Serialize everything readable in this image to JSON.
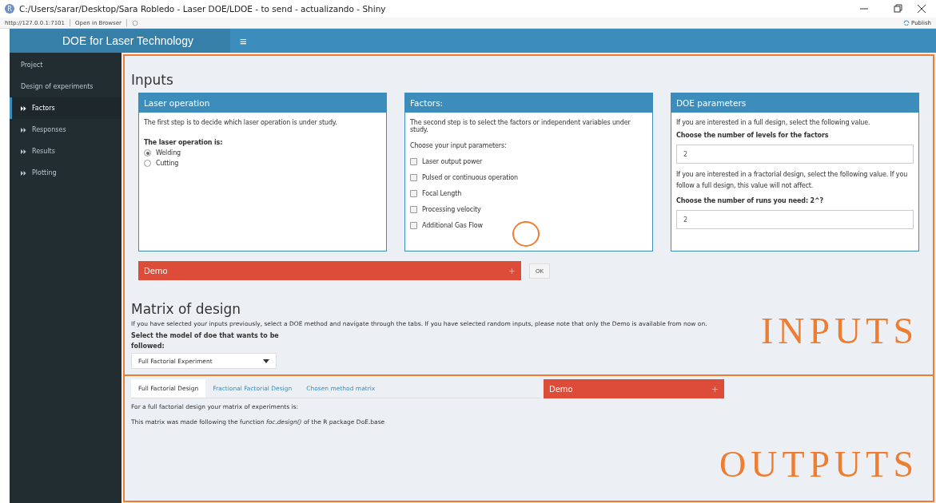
{
  "window": {
    "title": "C:/Users/sarar/Desktop/Sara Robledo - Laser DOE/LDOE - to send - actualizando - Shiny",
    "app_icon": "R"
  },
  "toolbar": {
    "url": "http://127.0.0.1:7101",
    "open_in_browser": "Open in Browser",
    "publish": "Publish"
  },
  "header": {
    "title": "DOE for Laser Technology",
    "menu": "≡"
  },
  "sidebar": {
    "items": [
      {
        "label": "Project",
        "kind": "plain",
        "selected": false
      },
      {
        "label": "Design of experiments",
        "kind": "plain",
        "selected": false
      },
      {
        "label": "Factors",
        "kind": "sub",
        "selected": true
      },
      {
        "label": "Responses",
        "kind": "sub",
        "selected": false
      },
      {
        "label": "Results",
        "kind": "sub",
        "selected": false
      },
      {
        "label": "Plotting",
        "kind": "sub",
        "selected": false
      }
    ]
  },
  "inputs": {
    "heading": "Inputs",
    "laser_operation": {
      "title": "Laser operation",
      "text": "The first step is to decide which laser operation is under study.",
      "label": "The laser operation is:",
      "options": [
        {
          "label": "Welding",
          "selected": true
        },
        {
          "label": "Cutting",
          "selected": false
        }
      ]
    },
    "factors": {
      "title": "Factors:",
      "text": "The second step is to select the factors or independent variables under study.",
      "label": "Choose your input parameters:",
      "options": [
        {
          "label": "Laser output power",
          "checked": false
        },
        {
          "label": "Pulsed or continuous operation",
          "checked": false
        },
        {
          "label": "Focal Length",
          "checked": false
        },
        {
          "label": "Processing velocity",
          "checked": false
        },
        {
          "label": "Additional Gas Flow",
          "checked": false
        }
      ]
    },
    "doe_parameters": {
      "title": "DOE parameters",
      "text_1": "If you are interested in a full design, select the following value.",
      "levels_label": "Choose the number of levels for the factors",
      "levels_value": "2",
      "text_2": "If you are interested in a fractorial design, select the following value. If you follow a full design, this value will not affect.",
      "runs_label": "Choose the number of runs you need: 2^?",
      "runs_value": "2"
    },
    "demo": {
      "title": "Demo",
      "toggle": "+"
    },
    "ok_button": "OK"
  },
  "matrix": {
    "heading": "Matrix of design",
    "text": "If you have selected your inputs previously, select a DOE method and navigate through the tabs. If you have selected random inputs, please note that only the Demo is available from now on.",
    "select_label": "Select the model of doe that wants to be followed:",
    "select_value": "Full Factorial Experiment"
  },
  "outputs": {
    "tabs": [
      {
        "label": "Full Factorial Design",
        "selected": true
      },
      {
        "label": "Fractional Factorial Design",
        "selected": false
      },
      {
        "label": "Chosen method matrix",
        "selected": false
      }
    ],
    "text": "For a full factorial design your matrix of experiments is:",
    "note": "This matrix was made following the function *foc.design()* of the R package DoE.base",
    "demo": {
      "title": "Demo",
      "toggle": "+"
    }
  },
  "annotations": {
    "inputs": "INPUTS",
    "outputs": "OUTPUTS"
  }
}
